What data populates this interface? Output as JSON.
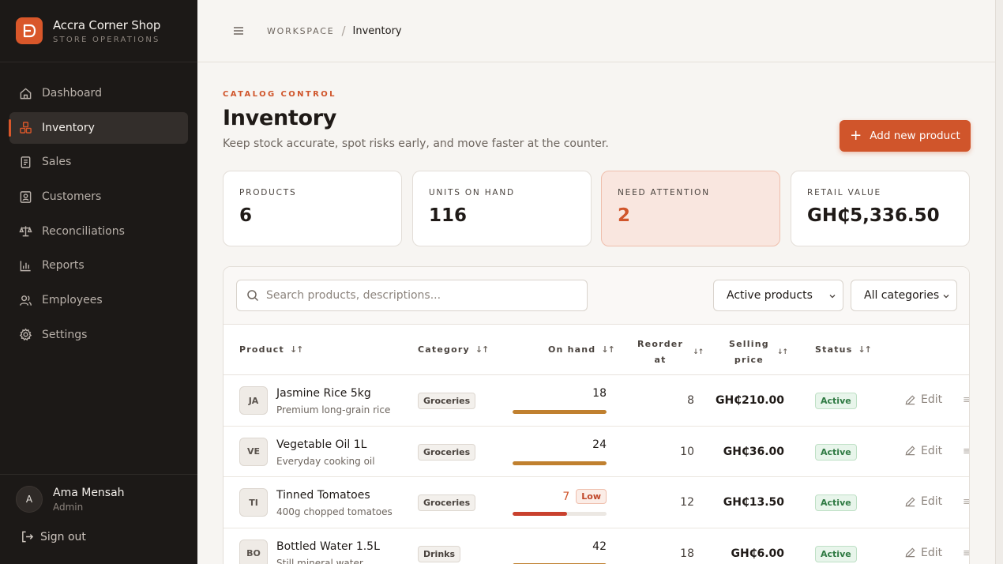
{
  "brand": {
    "name": "Accra Corner Shop",
    "subtitle": "STORE OPERATIONS"
  },
  "nav": [
    {
      "label": "Dashboard",
      "icon": "home-icon",
      "active": false
    },
    {
      "label": "Inventory",
      "icon": "boxes-icon",
      "active": true
    },
    {
      "label": "Sales",
      "icon": "receipt-icon",
      "active": false
    },
    {
      "label": "Customers",
      "icon": "contact-icon",
      "active": false
    },
    {
      "label": "Reconciliations",
      "icon": "scale-icon",
      "active": false
    },
    {
      "label": "Reports",
      "icon": "bar-chart-icon",
      "active": false
    },
    {
      "label": "Employees",
      "icon": "users-icon",
      "active": false
    },
    {
      "label": "Settings",
      "icon": "gear-icon",
      "active": false
    }
  ],
  "user": {
    "initial": "A",
    "name": "Ama Mensah",
    "role": "Admin",
    "signout_label": "Sign out"
  },
  "breadcrumb": {
    "root": "WORKSPACE",
    "separator": "/",
    "current": "Inventory"
  },
  "page": {
    "eyebrow": "CATALOG CONTROL",
    "title": "Inventory",
    "description": "Keep stock accurate, spot risks early, and move faster at the counter.",
    "add_button": "Add new product"
  },
  "stats": [
    {
      "label": "PRODUCTS",
      "value": "6",
      "alert": false
    },
    {
      "label": "UNITS ON HAND",
      "value": "116",
      "alert": false
    },
    {
      "label": "NEED ATTENTION",
      "value": "2",
      "alert": true
    },
    {
      "label": "RETAIL VALUE",
      "value": "GH₵5,336.50",
      "alert": false
    }
  ],
  "filters": {
    "search_placeholder": "Search products, descriptions...",
    "status_select": "Active products",
    "category_select": "All categories"
  },
  "table": {
    "headers": {
      "product": "Product",
      "category": "Category",
      "on_hand": "On hand",
      "reorder_line1": "Reorder",
      "reorder_line2": "at",
      "price_line1": "Selling",
      "price_line2": "price",
      "status": "Status",
      "sort_glyph": "↓↑"
    },
    "edit_label": "Edit",
    "low_label": "Low",
    "rows": [
      {
        "initials": "JA",
        "name": "Jasmine Rice 5kg",
        "description": "Premium long-grain rice",
        "category": "Groceries",
        "on_hand": "18",
        "stock_level": 1.0,
        "low": false,
        "reorder_at": "8",
        "price": "GH₵210.00",
        "status": "Active"
      },
      {
        "initials": "VE",
        "name": "Vegetable Oil 1L",
        "description": "Everyday cooking oil",
        "category": "Groceries",
        "on_hand": "24",
        "stock_level": 1.0,
        "low": false,
        "reorder_at": "10",
        "price": "GH₵36.00",
        "status": "Active"
      },
      {
        "initials": "TI",
        "name": "Tinned Tomatoes",
        "description": "400g chopped tomatoes",
        "category": "Groceries",
        "on_hand": "7",
        "stock_level": 0.58,
        "low": true,
        "reorder_at": "12",
        "price": "GH₵13.50",
        "status": "Active"
      },
      {
        "initials": "BO",
        "name": "Bottled Water 1.5L",
        "description": "Still mineral water",
        "category": "Drinks",
        "on_hand": "42",
        "stock_level": 1.0,
        "low": false,
        "reorder_at": "18",
        "price": "GH₵6.00",
        "status": "Active"
      }
    ]
  },
  "colors": {
    "accent": "#d0552b",
    "sidebar": "#1c1917",
    "stock_bar": "#c0802f",
    "stock_low": "#c9412e",
    "active_badge": "#2f7a43"
  }
}
